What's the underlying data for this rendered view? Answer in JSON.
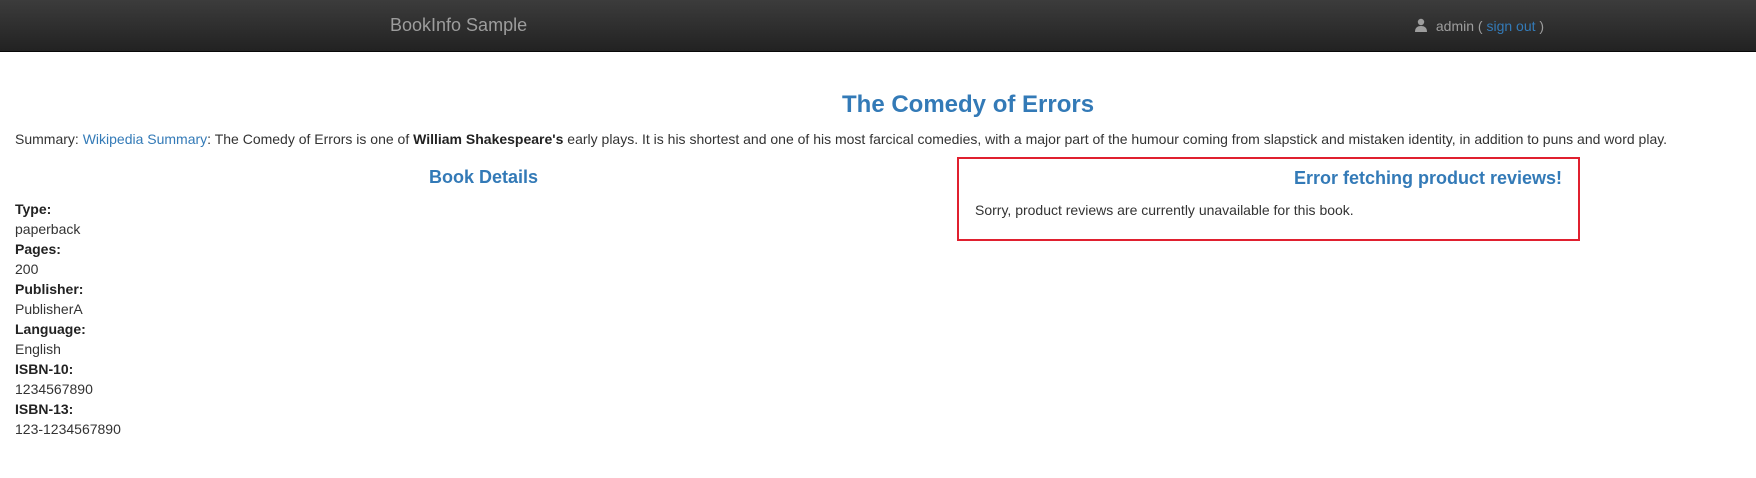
{
  "navbar": {
    "brand": "BookInfo Sample",
    "user": {
      "icon": "user-icon",
      "name": "admin",
      "open_paren": "(",
      "sign_out": "sign out",
      "close_paren": ")"
    }
  },
  "product": {
    "title": "The Comedy of Errors",
    "summary": {
      "label": "Summary: ",
      "link_text": "Wikipedia Summary",
      "text_before_bold": ": The Comedy of Errors is one of ",
      "bold": "William Shakespeare's",
      "text_after_bold": " early plays. It is his shortest and one of his most farcical comedies, with a major part of the humour coming from slapstick and mistaken identity, in addition to puns and word play."
    }
  },
  "details": {
    "heading": "Book Details",
    "items": [
      {
        "label": "Type:",
        "value": "paperback"
      },
      {
        "label": "Pages:",
        "value": "200"
      },
      {
        "label": "Publisher:",
        "value": "PublisherA"
      },
      {
        "label": "Language:",
        "value": "English"
      },
      {
        "label": "ISBN-10:",
        "value": "1234567890"
      },
      {
        "label": "ISBN-13:",
        "value": "123-1234567890"
      }
    ]
  },
  "reviews": {
    "heading": "Error fetching product reviews!",
    "message": "Sorry, product reviews are currently unavailable for this book."
  },
  "colors": {
    "link": "#337ab7",
    "error_border": "#e0202f",
    "navbar": "#222222"
  }
}
